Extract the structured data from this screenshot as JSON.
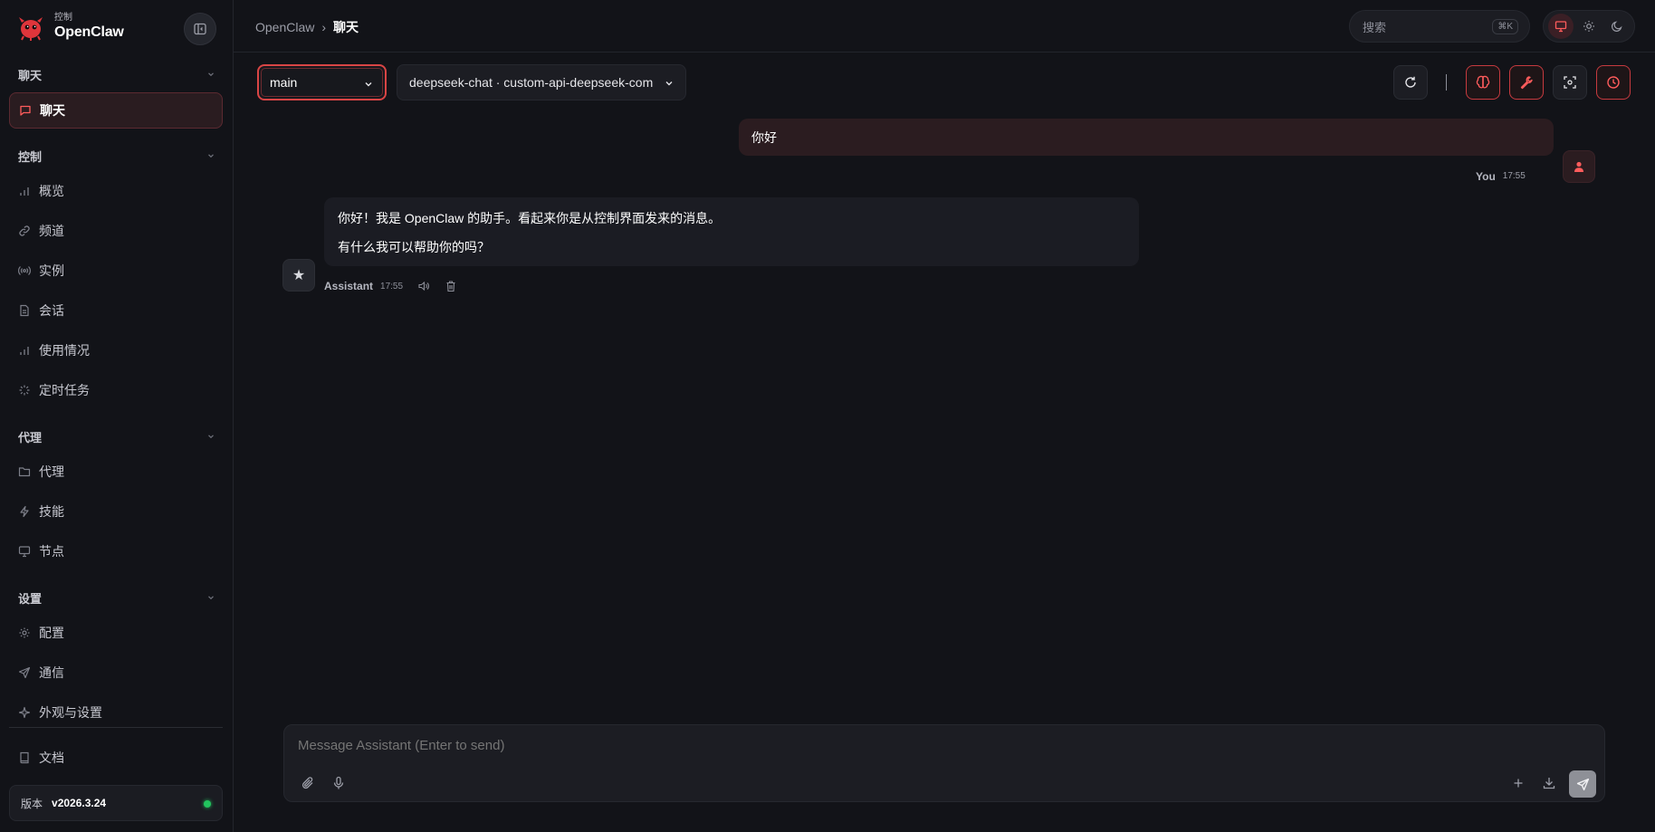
{
  "brand": {
    "subtitle": "控制",
    "name": "OpenClaw"
  },
  "sidebar": {
    "sections": [
      {
        "title": "聊天",
        "items": [
          {
            "label": "聊天",
            "icon": "message-icon",
            "active": true
          }
        ]
      },
      {
        "title": "控制",
        "items": [
          {
            "label": "概览",
            "icon": "bar-chart-icon"
          },
          {
            "label": "频道",
            "icon": "link-icon"
          },
          {
            "label": "实例",
            "icon": "radio-icon"
          },
          {
            "label": "会话",
            "icon": "file-icon"
          },
          {
            "label": "使用情况",
            "icon": "bar-chart-icon"
          },
          {
            "label": "定时任务",
            "icon": "loader-icon"
          }
        ]
      },
      {
        "title": "代理",
        "items": [
          {
            "label": "代理",
            "icon": "folder-icon"
          },
          {
            "label": "技能",
            "icon": "zap-icon"
          },
          {
            "label": "节点",
            "icon": "monitor-icon"
          }
        ]
      },
      {
        "title": "设置",
        "items": [
          {
            "label": "配置",
            "icon": "gear-icon"
          },
          {
            "label": "通信",
            "icon": "send-icon"
          },
          {
            "label": "外观与设置",
            "icon": "sparkle-icon"
          }
        ]
      }
    ],
    "docs_label": "文档",
    "version_label": "版本",
    "version_value": "v2026.3.24"
  },
  "header": {
    "breadcrumb_root": "OpenClaw",
    "breadcrumb_sep": "›",
    "breadcrumb_current": "聊天",
    "search_placeholder": "搜索",
    "search_shortcut": "⌘K"
  },
  "toolbar": {
    "agent_value": "main",
    "model_value": "deepseek-chat · custom-api-deepseek-com"
  },
  "messages": {
    "user": {
      "text": "你好",
      "sender": "You",
      "time": "17:55"
    },
    "assistant": {
      "lines": [
        "你好！我是 OpenClaw 的助手。看起来你是从控制界面发来的消息。",
        "有什么我可以帮助你的吗？"
      ],
      "sender": "Assistant",
      "time": "17:55",
      "avatar_glyph": "★"
    }
  },
  "composer": {
    "placeholder": "Message Assistant (Enter to send)"
  },
  "colors": {
    "accent": "#e04848",
    "background": "#121318",
    "online": "#22c55e"
  }
}
